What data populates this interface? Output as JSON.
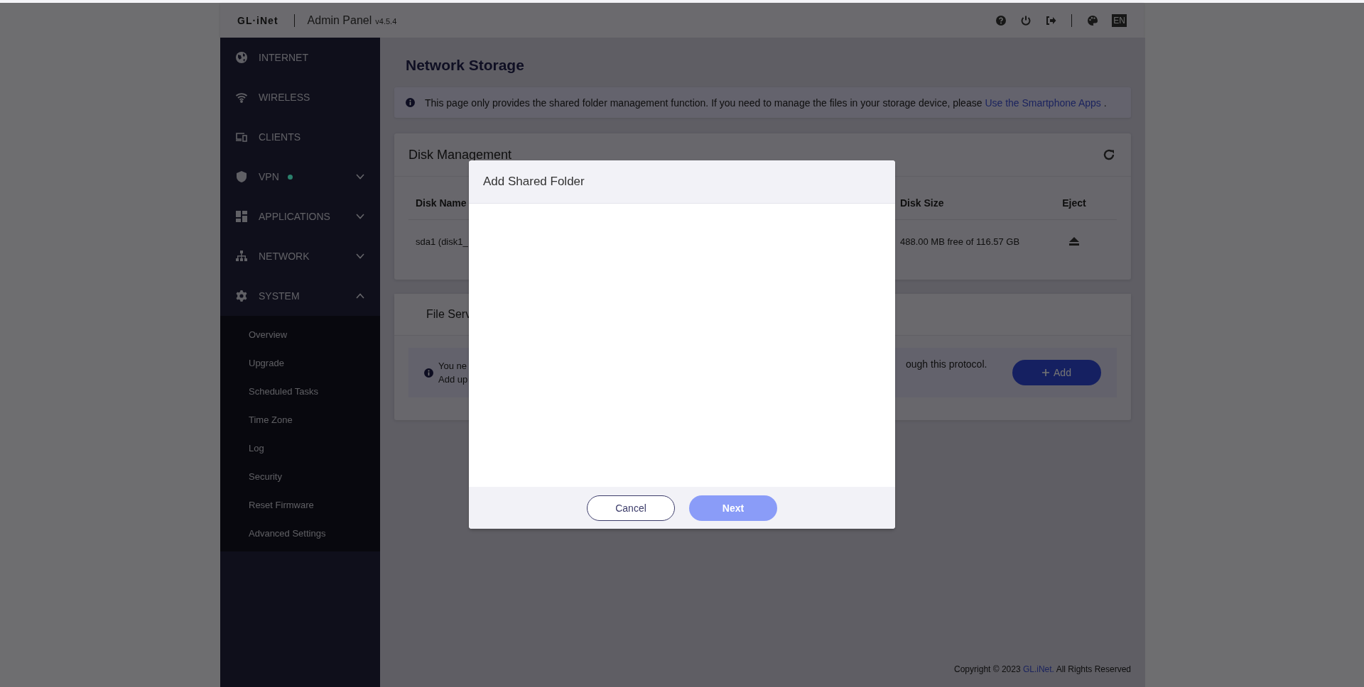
{
  "header": {
    "logo": "GL·iNet",
    "title": "Admin Panel",
    "version": "v4.5.4",
    "language": "EN"
  },
  "sidebar": {
    "items": [
      {
        "label": "INTERNET",
        "kind": "link"
      },
      {
        "label": "WIRELESS",
        "kind": "link"
      },
      {
        "label": "CLIENTS",
        "kind": "link"
      },
      {
        "label": "VPN",
        "kind": "group",
        "expanded": false,
        "color": "#2b806c"
      },
      {
        "label": "APPLICATIONS",
        "kind": "group",
        "expanded": false
      },
      {
        "label": "NETWORK",
        "kind": "group",
        "expanded": false
      },
      {
        "label": "SYSTEM",
        "kind": "group",
        "expanded": true,
        "children": [
          {
            "label": "Overview"
          },
          {
            "label": "Upgrade"
          },
          {
            "label": "Scheduled Tasks"
          },
          {
            "label": "Time Zone"
          },
          {
            "label": "Log"
          },
          {
            "label": "Security"
          },
          {
            "label": "Reset Firmware"
          },
          {
            "label": "Advanced Settings"
          }
        ]
      }
    ]
  },
  "page": {
    "title": "Network Storage",
    "notice": {
      "text": "This page only provides the shared folder management function. If you need to manage the files in your storage device, please ",
      "link": "Use the Smartphone Apps",
      "after": " ."
    },
    "disk_management": {
      "title": "Disk Management",
      "columns": [
        "Disk Name",
        "Disk Size",
        "Eject"
      ],
      "rows": [
        {
          "name": "sda1 (disk1_",
          "size": "488.00 MB free of 116.57 GB"
        }
      ]
    },
    "file_services": {
      "tab": "File Serv",
      "line_1_start": "You ne",
      "line_2_start": "Add up",
      "line_1_end": "ough this protocol.",
      "add_button": "Add"
    }
  },
  "dialog": {
    "title": "Add Shared Folder",
    "buttons": [
      {
        "label": "Cancel",
        "kind": "secondary",
        "disabled": false
      },
      {
        "label": "Next",
        "kind": "primary",
        "disabled": true
      }
    ]
  },
  "footer": {
    "text": "Copyright © 2023 ",
    "link": "GL.iNet.",
    "after": " All Rights Reserved"
  }
}
